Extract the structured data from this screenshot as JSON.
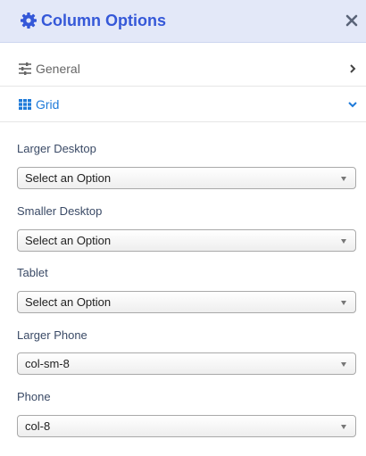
{
  "header": {
    "title": "Column Options",
    "gear_icon": "gear-icon",
    "close_icon": "close-icon",
    "title_color": "#3558d8"
  },
  "sections": {
    "general": {
      "label": "General",
      "icon": "sliders-icon",
      "chevron": "chevron-right-icon"
    },
    "grid": {
      "label": "Grid",
      "icon": "grid-icon",
      "chevron": "chevron-down-icon",
      "active_color": "#1e7ad9"
    }
  },
  "fields": [
    {
      "label": "Larger Desktop",
      "value": "Select an Option"
    },
    {
      "label": "Smaller Desktop",
      "value": "Select an Option"
    },
    {
      "label": "Tablet",
      "value": "Select an Option"
    },
    {
      "label": "Larger Phone",
      "value": "col-sm-8"
    },
    {
      "label": "Phone",
      "value": "col-8"
    }
  ]
}
